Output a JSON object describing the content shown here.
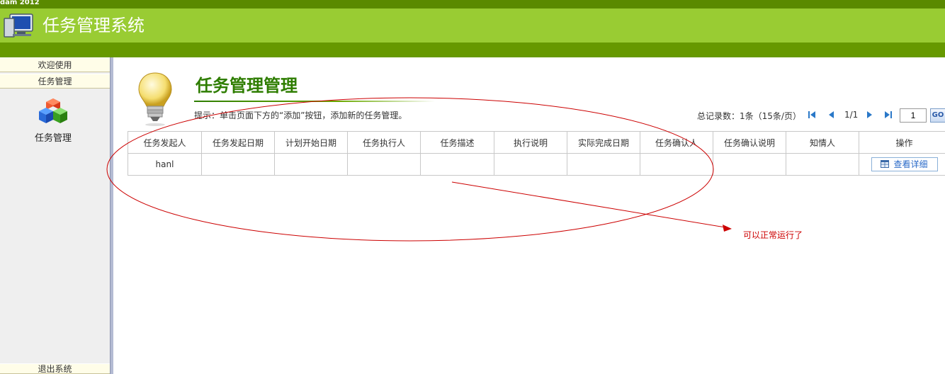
{
  "app": {
    "corner_tag": "dam 2012",
    "title": "任务管理系统"
  },
  "sidebar": {
    "items": [
      {
        "label": "欢迎使用"
      },
      {
        "label": "任务管理"
      }
    ],
    "module": {
      "label": "任务管理",
      "icon": "cubes-icon"
    },
    "logout_label": "退出系统"
  },
  "main": {
    "page_title": "任务管理管理",
    "hint": "提示：单击页面下方的“添加”按钮，添加新的任务管理。",
    "pager": {
      "total_text": "总记录数：1条（15条/页）",
      "page_info": "1/1",
      "page_input": "1",
      "go_label": "GO"
    },
    "table": {
      "columns": [
        "任务发起人",
        "任务发起日期",
        "计划开始日期",
        "任务执行人",
        "任务描述",
        "执行说明",
        "实际完成日期",
        "任务确认人",
        "任务确认说明",
        "知情人",
        "操作"
      ],
      "rows": [
        {
          "cells": [
            "hanl",
            "",
            "",
            "",
            "",
            "",
            "",
            "",
            "",
            ""
          ],
          "action_label": "查看详细"
        }
      ]
    }
  },
  "annotation": {
    "text": "可以正常运行了",
    "color": "#cc0000"
  },
  "colors": {
    "header_green": "#99cc33",
    "dark_green": "#669900",
    "title_green": "#2e7d00"
  }
}
